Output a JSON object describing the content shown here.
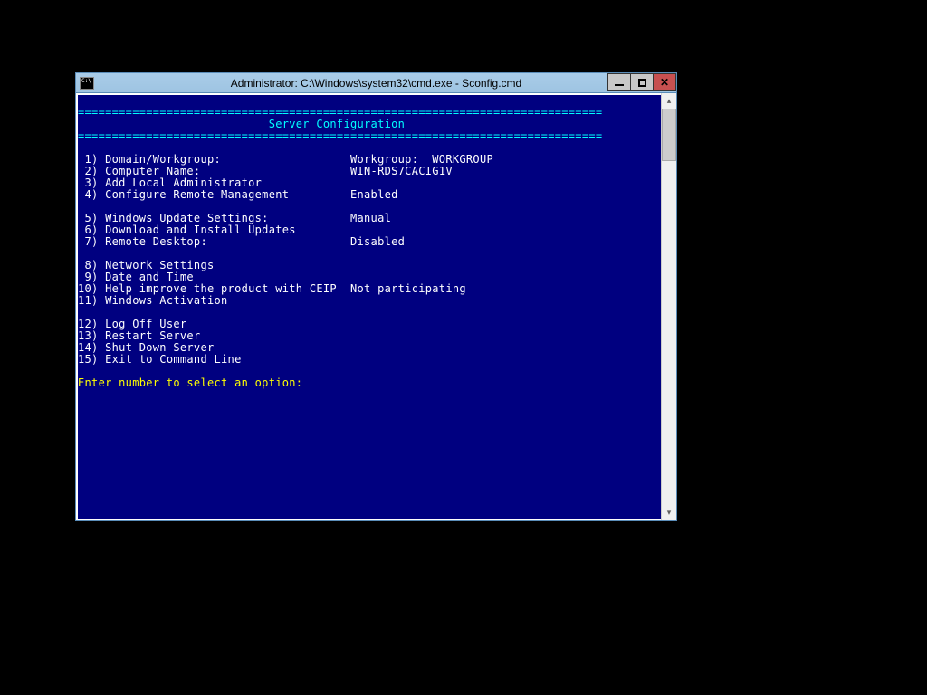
{
  "window": {
    "title": "Administrator: C:\\Windows\\system32\\cmd.exe - Sconfig.cmd"
  },
  "header": "Server Configuration",
  "rule": "=============================================================================",
  "menu": [
    {
      "num": "1",
      "label": "Domain/Workgroup:",
      "value": "Workgroup:  WORKGROUP"
    },
    {
      "num": "2",
      "label": "Computer Name:",
      "value": "WIN-RDS7CACIG1V"
    },
    {
      "num": "3",
      "label": "Add Local Administrator",
      "value": ""
    },
    {
      "num": "4",
      "label": "Configure Remote Management",
      "value": "Enabled"
    },
    {
      "num": "",
      "label": "",
      "value": ""
    },
    {
      "num": "5",
      "label": "Windows Update Settings:",
      "value": "Manual"
    },
    {
      "num": "6",
      "label": "Download and Install Updates",
      "value": ""
    },
    {
      "num": "7",
      "label": "Remote Desktop:",
      "value": "Disabled"
    },
    {
      "num": "",
      "label": "",
      "value": ""
    },
    {
      "num": "8",
      "label": "Network Settings",
      "value": ""
    },
    {
      "num": "9",
      "label": "Date and Time",
      "value": ""
    },
    {
      "num": "10",
      "label": "Help improve the product with CEIP",
      "value": "Not participating"
    },
    {
      "num": "11",
      "label": "Windows Activation",
      "value": ""
    },
    {
      "num": "",
      "label": "",
      "value": ""
    },
    {
      "num": "12",
      "label": "Log Off User",
      "value": ""
    },
    {
      "num": "13",
      "label": "Restart Server",
      "value": ""
    },
    {
      "num": "14",
      "label": "Shut Down Server",
      "value": ""
    },
    {
      "num": "15",
      "label": "Exit to Command Line",
      "value": ""
    }
  ],
  "prompt": "Enter number to select an option:"
}
